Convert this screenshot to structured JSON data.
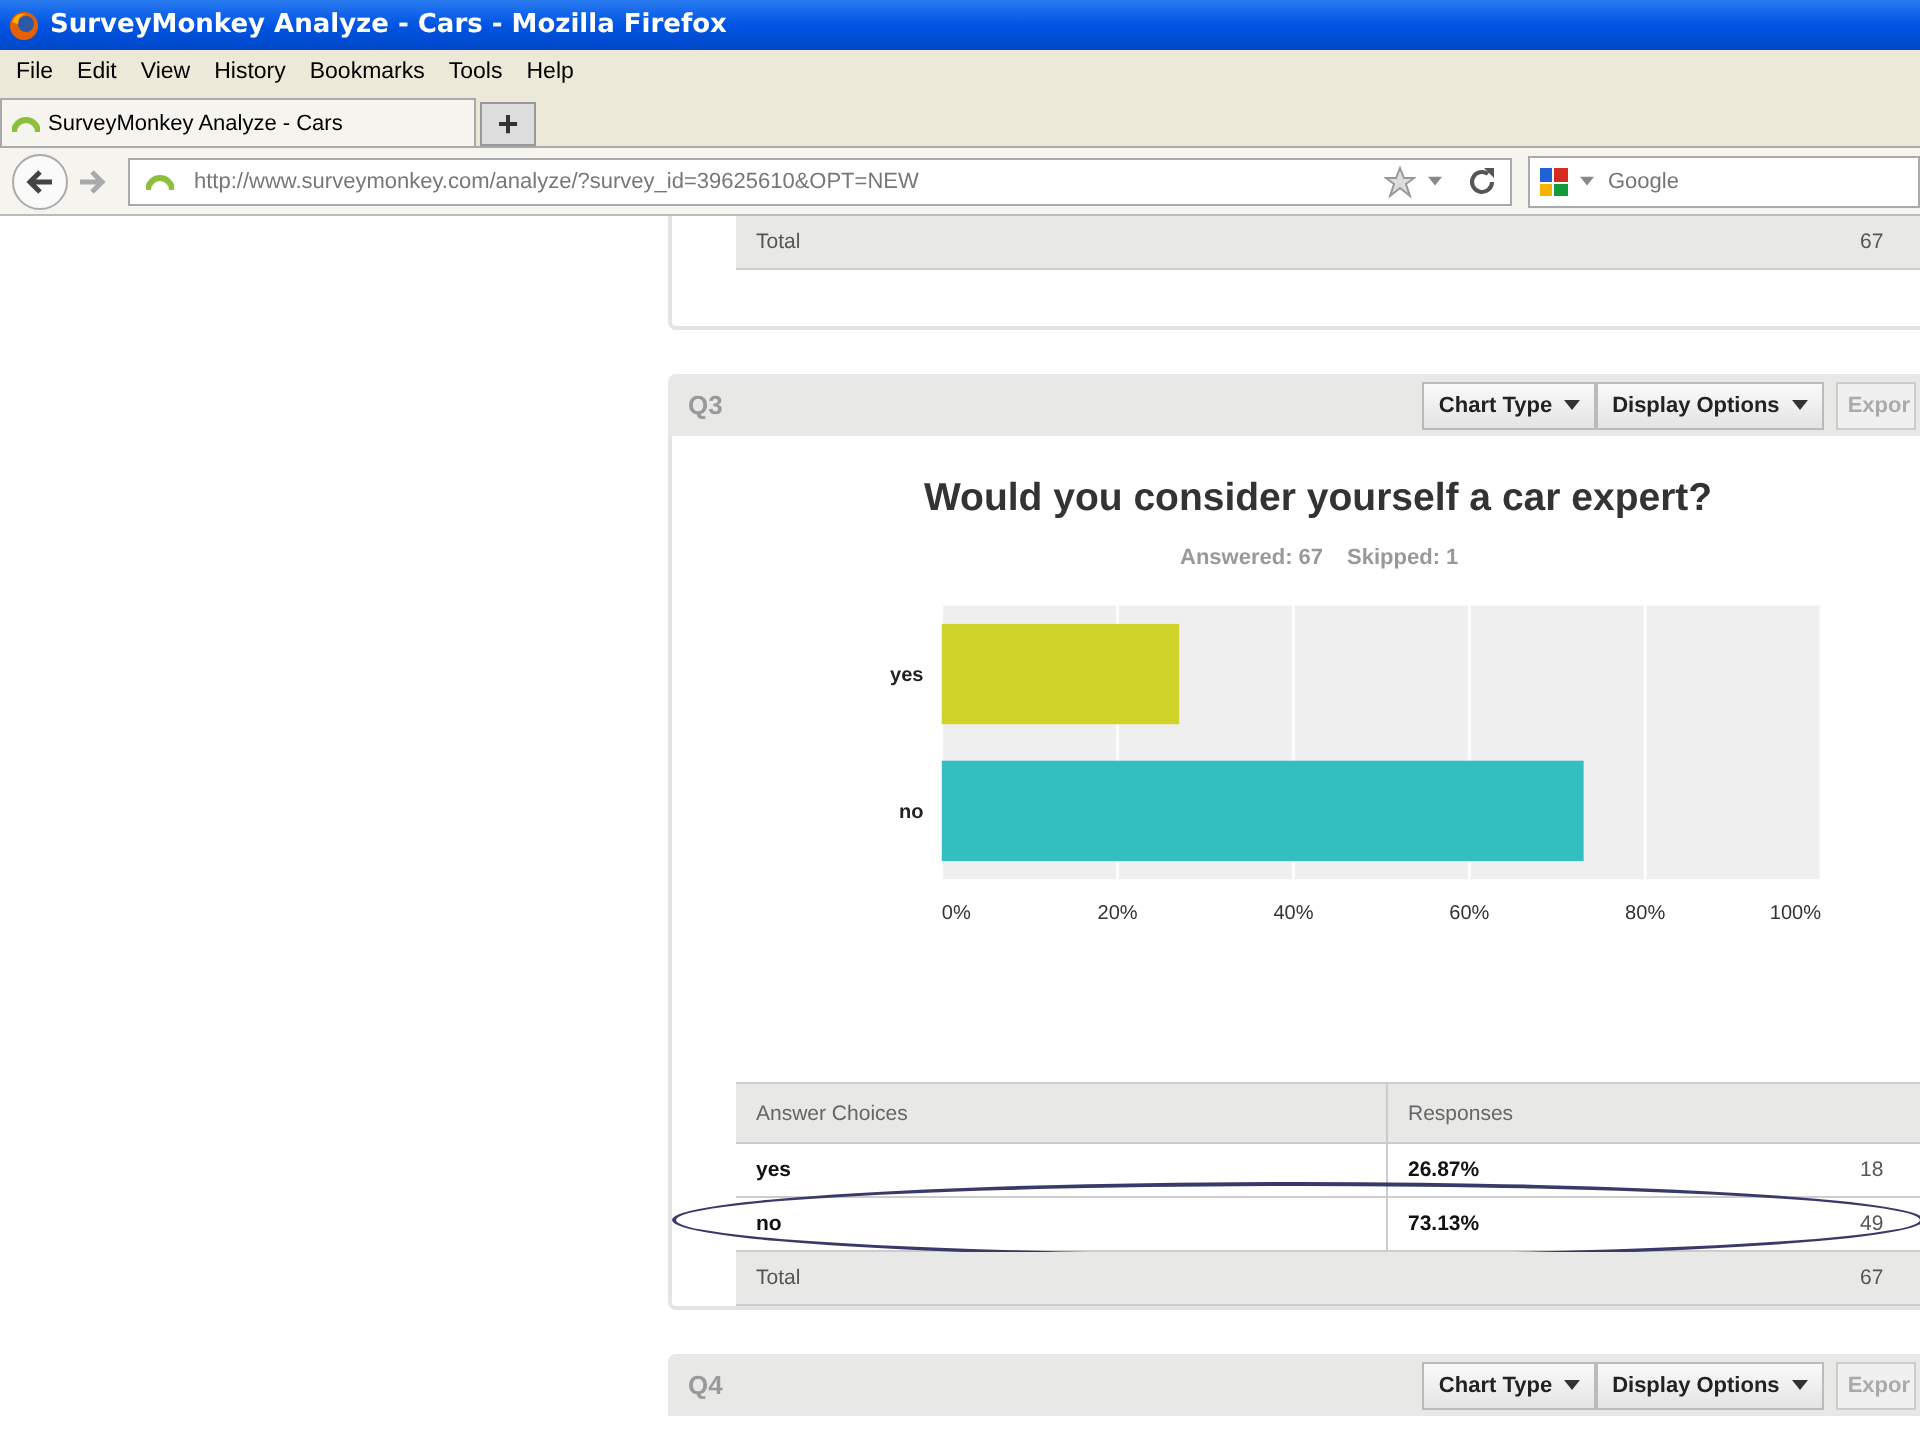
{
  "window": {
    "title": "SurveyMonkey Analyze - Cars - Mozilla Firefox"
  },
  "menu": [
    "File",
    "Edit",
    "View",
    "History",
    "Bookmarks",
    "Tools",
    "Help"
  ],
  "tabs": [
    {
      "label": "SurveyMonkey Analyze - Cars",
      "selected": true
    }
  ],
  "new_tab": "+",
  "address_bar": {
    "value": "http://www.surveymonkey.com/analyze/?survey_id=39625610&OPT=NEW"
  },
  "search": {
    "placeholder": "Google"
  },
  "previous_panel": {
    "total_label": "Total",
    "total_value": "67"
  },
  "question": {
    "number": "Q3",
    "buttons": [
      "Chart Type",
      "Display Options"
    ],
    "export": "Expor",
    "title": "Would you consider yourself a car expert?",
    "answered": "Answered: 67",
    "skipped": "Skipped: 1",
    "chart_data": {
      "type": "bar",
      "orientation": "horizontal",
      "grid": true,
      "categories": [
        "yes",
        "no"
      ],
      "series": [
        {
          "color": "#d0d42a",
          "values": [
            27,
            null
          ]
        },
        {
          "color": "#33bfbf",
          "values": [
            null,
            73
          ]
        }
      ],
      "xlim": [
        0,
        100
      ],
      "xticks": [
        {
          "value": 0,
          "label": "0%"
        },
        {
          "value": 20,
          "label": "20%"
        },
        {
          "value": 40,
          "label": "40%"
        },
        {
          "value": 60,
          "label": "60%"
        },
        {
          "value": 80,
          "label": "80%"
        },
        {
          "value": 100,
          "label": "100%"
        }
      ]
    },
    "table": {
      "columns": [
        "Answer Choices",
        "Responses"
      ],
      "rows": [
        {
          "choice": "yes",
          "percent": "26.87%",
          "count": "18",
          "circled": false
        },
        {
          "choice": "no",
          "percent": "73.13%",
          "count": "49",
          "circled": true
        }
      ],
      "total_label": "Total",
      "total_value": "67"
    }
  },
  "next_question": {
    "number": "Q4",
    "buttons": [
      "Chart Type",
      "Display Options"
    ],
    "export": "Expor"
  }
}
